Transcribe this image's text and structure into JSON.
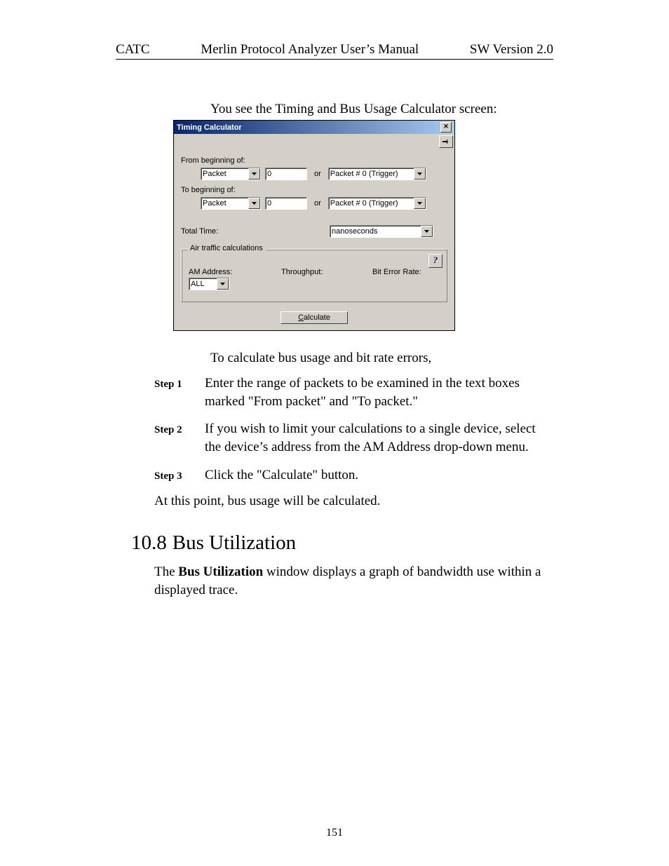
{
  "header": {
    "left": "CATC",
    "center": "Merlin Protocol Analyzer User’s Manual",
    "right": "SW Version 2.0"
  },
  "intro": "You see the Timing and Bus Usage Calculator screen:",
  "dialog": {
    "title": "Timing Calculator",
    "close_glyph": "✕",
    "pin_tooltip": "Pin",
    "from_label": "From beginning of:",
    "from_type": "Packet",
    "from_value": "0",
    "or_label": "or",
    "from_packet": "Packet # 0 (Trigger)",
    "to_label": "To beginning of:",
    "to_type": "Packet",
    "to_value": "0",
    "to_packet": "Packet # 0 (Trigger)",
    "total_time_label": "Total Time:",
    "time_unit": "nanoseconds",
    "group_legend": "Air traffic calculations",
    "help_glyph": "?",
    "am_label": "AM Address:",
    "am_value": "ALL",
    "throughput_label": "Throughput:",
    "ber_label": "Bit Error Rate:",
    "calculate_prefix": "C",
    "calculate_rest": "alculate"
  },
  "after_intro": "To calculate bus usage and bit rate errors,",
  "steps": [
    {
      "label": "Step 1",
      "text": "Enter the range of packets to be examined in the text boxes marked \"From packet\" and \"To packet.\""
    },
    {
      "label": "Step 2",
      "text": "If you wish to limit your calculations to a single device, select the device’s address from the AM Address drop-down menu."
    },
    {
      "label": "Step 3",
      "text": "Click the \"Calculate\" button."
    }
  ],
  "followup": "At this point, bus usage will be calculated.",
  "section": {
    "number": "10.8",
    "title": "Bus Utilization"
  },
  "para_pre": "The ",
  "para_bold": "Bus Utilization",
  "para_post": " window displays a graph of bandwidth use within a displayed trace.",
  "page_number": "151"
}
